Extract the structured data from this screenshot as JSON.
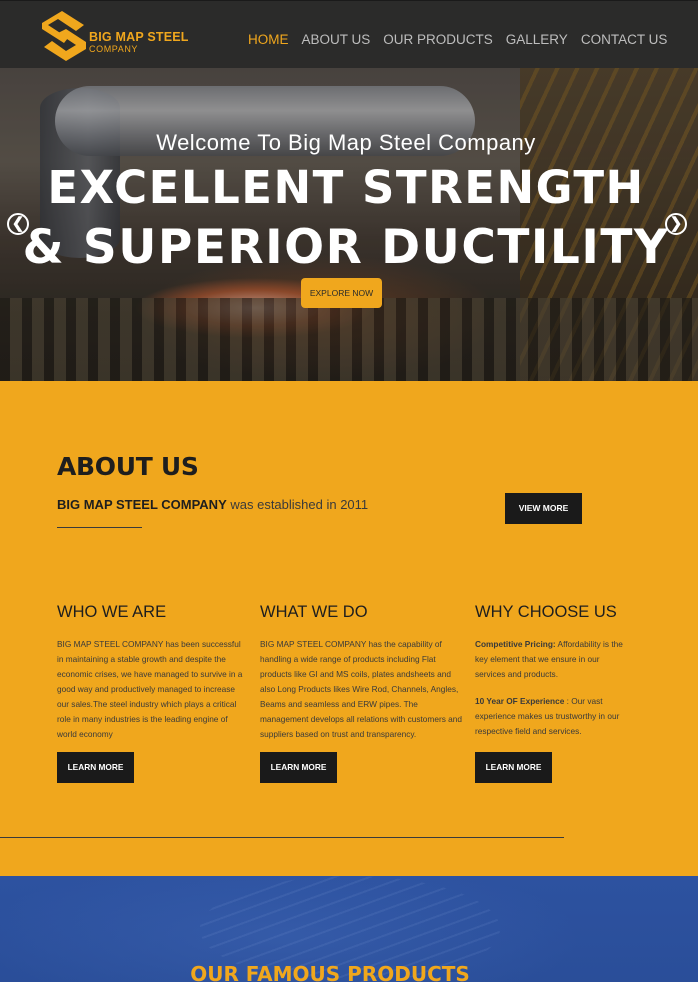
{
  "brand": {
    "name": "BIG MAP STEEL",
    "sub": "COMPANY",
    "color": "#f0a71d"
  },
  "nav": [
    {
      "label": "HOME",
      "active": true
    },
    {
      "label": "ABOUT US"
    },
    {
      "label": "OUR PRODUCTS"
    },
    {
      "label": "GALLERY"
    },
    {
      "label": "CONTACT US"
    }
  ],
  "hero": {
    "welcome": "Welcome To Big Map Steel Company",
    "line1": "EXCELLENT STRENGTH",
    "line2": "& SUPERIOR DUCTILITY",
    "cta": "EXPLORE NOW",
    "prev": "❮",
    "next": "❯"
  },
  "about": {
    "title": "ABOUT US",
    "company": "BIG MAP STEEL COMPANY",
    "established": " was established in 2011",
    "view_more": "VIEW MORE"
  },
  "columns": [
    {
      "title": "WHO WE ARE",
      "text": "BIG MAP STEEL COMPANY has been successful in maintaining a stable growth and despite the economic crises, we have managed to survive in a good way and productively managed to increase our sales.The steel industry which plays a critical role in many industries is the leading engine of world economy",
      "button": "LEARN MORE"
    },
    {
      "title": "WHAT WE DO",
      "text": "BIG MAP STEEL COMPANY has the capability of handling a wide range of products including Flat products like GI and MS coils, plates andsheets and also Long Products likes Wire Rod, Channels, Angles, Beams and seamless and ERW pipes. The management develops all relations with customers and suppliers based on trust and transparency.",
      "button": "LEARN MORE"
    },
    {
      "title": "WHY CHOOSE US",
      "p1_label": "Competitive Pricing:",
      "p1_text": " Affordability is the key element that we ensure in our services and products.",
      "p2_label": "10 Year OF Experience",
      "p2_text": " : Our vast experience makes us trustworthy in our respective field and services.",
      "button": "LEARN MORE"
    }
  ],
  "products": {
    "title": "OUR FAMOUS PRODUCTS"
  }
}
